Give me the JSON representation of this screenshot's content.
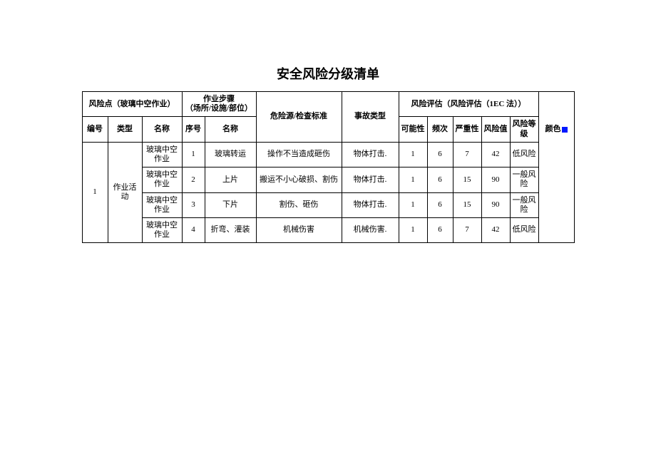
{
  "title": "安全风险分级清单",
  "headers": {
    "riskPoint": "风险点（玻璃中空作业）",
    "step": "作业步骤\n（场所/设施/部位）",
    "hazard": "危险源/检查标准",
    "accident": "事故类型",
    "assessment": "风险评估（风险评估（1EC 法））",
    "no": "编号",
    "type": "类型",
    "name": "名称",
    "sn": "序号",
    "sname": "名称",
    "prob": "可能性",
    "freq": "频次",
    "sev": "严重性",
    "riskVal": "风险值",
    "riskLevel": "风险等级",
    "color": "颜色"
  },
  "group": {
    "no": "1",
    "type": "作业活动"
  },
  "rows": [
    {
      "name": "玻璃中空作业",
      "sn": "1",
      "sname": "玻璃转运",
      "hazard": "操作不当造成砸伤",
      "accident": "物体打击.",
      "prob": "1",
      "freq": "6",
      "sev": "7",
      "riskVal": "42",
      "riskLevel": "低风险"
    },
    {
      "name": "玻璃中空作业",
      "sn": "2",
      "sname": "上片",
      "hazard": "搬运不小心破损、割伤",
      "accident": "物体打击.",
      "prob": "1",
      "freq": "6",
      "sev": "15",
      "riskVal": "90",
      "riskLevel": "一般风险"
    },
    {
      "name": "玻璃中空作业",
      "sn": "3",
      "sname": "下片",
      "hazard": "割伤、砸伤",
      "accident": "物体打击.",
      "prob": "1",
      "freq": "6",
      "sev": "15",
      "riskVal": "90",
      "riskLevel": "一般风险"
    },
    {
      "name": "玻璃中空作业",
      "sn": "4",
      "sname": "折弯、灌装",
      "hazard": "机械伤害",
      "accident": "机械伤害.",
      "prob": "1",
      "freq": "6",
      "sev": "7",
      "riskVal": "42",
      "riskLevel": "低风险"
    }
  ],
  "chart_data": {
    "type": "table",
    "title": "安全风险分级清单",
    "columns": [
      "编号",
      "类型",
      "名称",
      "序号",
      "步骤名称",
      "危险源/检查标准",
      "事故类型",
      "可能性",
      "频次",
      "严重性",
      "风险值",
      "风险等级"
    ],
    "rows": [
      [
        1,
        "作业活动",
        "玻璃中空作业",
        1,
        "玻璃转运",
        "操作不当造成砸伤",
        "物体打击",
        1,
        6,
        7,
        42,
        "低风险"
      ],
      [
        1,
        "作业活动",
        "玻璃中空作业",
        2,
        "上片",
        "搬运不小心破损、割伤",
        "物体打击",
        1,
        6,
        15,
        90,
        "一般风险"
      ],
      [
        1,
        "作业活动",
        "玻璃中空作业",
        3,
        "下片",
        "割伤、砸伤",
        "物体打击",
        1,
        6,
        15,
        90,
        "一般风险"
      ],
      [
        1,
        "作业活动",
        "玻璃中空作业",
        4,
        "折弯、灌装",
        "机械伤害",
        "机械伤害",
        1,
        6,
        7,
        42,
        "低风险"
      ]
    ]
  }
}
